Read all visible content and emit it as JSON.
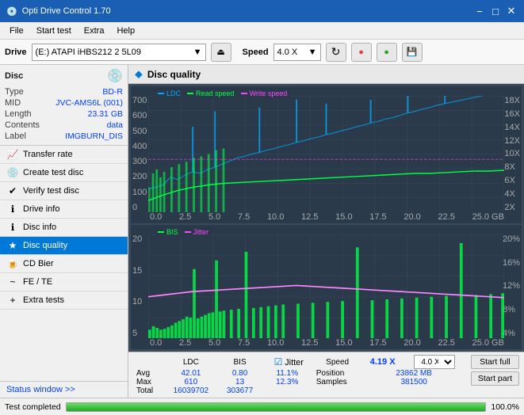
{
  "titlebar": {
    "title": "Opti Drive Control 1.70",
    "icon": "💿",
    "minimize": "−",
    "maximize": "□",
    "close": "✕"
  },
  "menubar": {
    "items": [
      "File",
      "Start test",
      "Extra",
      "Help"
    ]
  },
  "drive_toolbar": {
    "drive_label": "Drive",
    "drive_value": "(E:)  ATAPI iHBS212  2 5L09",
    "eject_icon": "⏏",
    "speed_label": "Speed",
    "speed_value": "4.0 X",
    "refresh_icon": "↻",
    "btn1": "🔴",
    "btn2": "🟢",
    "btn3": "💾"
  },
  "sidebar": {
    "disc_section": {
      "title": "Disc",
      "icon": "💿",
      "fields": [
        {
          "key": "Type",
          "val": "BD-R"
        },
        {
          "key": "MID",
          "val": "JVC-AMS6L (001)"
        },
        {
          "key": "Length",
          "val": "23.31 GB"
        },
        {
          "key": "Contents",
          "val": "data"
        },
        {
          "key": "Label",
          "val": "IMGBURN_DIS"
        }
      ]
    },
    "nav": [
      {
        "id": "transfer-rate",
        "label": "Transfer rate",
        "active": false
      },
      {
        "id": "create-test-disc",
        "label": "Create test disc",
        "active": false
      },
      {
        "id": "verify-test-disc",
        "label": "Verify test disc",
        "active": false
      },
      {
        "id": "drive-info",
        "label": "Drive info",
        "active": false
      },
      {
        "id": "disc-info",
        "label": "Disc info",
        "active": false
      },
      {
        "id": "disc-quality",
        "label": "Disc quality",
        "active": true
      },
      {
        "id": "cd-bier",
        "label": "CD Bier",
        "active": false
      },
      {
        "id": "fe-te",
        "label": "FE / TE",
        "active": false
      },
      {
        "id": "extra-tests",
        "label": "Extra tests",
        "active": false
      }
    ],
    "status_window": "Status window >>"
  },
  "content": {
    "header": {
      "icon": "⬥",
      "title": "Disc quality"
    },
    "chart1": {
      "legend": [
        {
          "label": "LDC",
          "color": "#00aaff"
        },
        {
          "label": "Read speed",
          "color": "#00ff44"
        },
        {
          "label": "Write speed",
          "color": "#ff44ff"
        }
      ],
      "y_left": [
        "700",
        "600",
        "500",
        "400",
        "300",
        "200",
        "100",
        "0"
      ],
      "y_right": [
        "18X",
        "16X",
        "14X",
        "12X",
        "10X",
        "8X",
        "6X",
        "4X",
        "2X"
      ],
      "x_labels": [
        "0.0",
        "2.5",
        "5.0",
        "7.5",
        "10.0",
        "12.5",
        "15.0",
        "17.5",
        "20.0",
        "22.5",
        "25.0 GB"
      ]
    },
    "chart2": {
      "legend": [
        {
          "label": "BIS",
          "color": "#00ff44"
        },
        {
          "label": "Jitter",
          "color": "#ff44ff"
        }
      ],
      "y_left": [
        "20",
        "15",
        "10",
        "5"
      ],
      "y_right": [
        "20%",
        "16%",
        "12%",
        "8%",
        "4%"
      ],
      "x_labels": [
        "0.0",
        "2.5",
        "5.0",
        "7.5",
        "10.0",
        "12.5",
        "15.0",
        "17.5",
        "20.0",
        "22.5",
        "25.0 GB"
      ]
    }
  },
  "stats": {
    "headers": [
      "",
      "LDC",
      "BIS",
      "",
      "Jitter",
      "Speed",
      "",
      ""
    ],
    "rows": [
      {
        "label": "Avg",
        "ldc": "42.01",
        "bis": "0.80",
        "jitter": "11.1%"
      },
      {
        "label": "Max",
        "ldc": "610",
        "bis": "13",
        "jitter": "12.3%"
      },
      {
        "label": "Total",
        "ldc": "16039702",
        "bis": "303677",
        "jitter": ""
      }
    ],
    "jitter_checked": true,
    "speed_value": "4.19 X",
    "speed_select": "4.0 X",
    "position_label": "Position",
    "position_value": "23862 MB",
    "samples_label": "Samples",
    "samples_value": "381500",
    "btn_start_full": "Start full",
    "btn_start_part": "Start part"
  },
  "statusbar": {
    "text": "Test completed",
    "progress": 100,
    "progress_pct": "100.0%"
  }
}
